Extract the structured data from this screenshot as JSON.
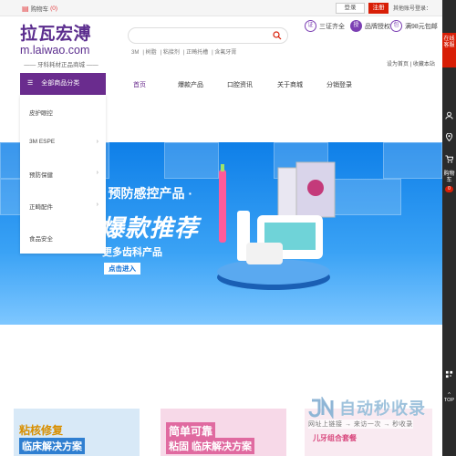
{
  "topbar": {
    "cart_label": "购物车",
    "cart_count": "(0)",
    "login": "登录",
    "register": "注册",
    "other_login": "其他账号登录："
  },
  "logo": {
    "cn": "拉瓦宏溥",
    "en": "m.laiwao.com",
    "tagline": "—— 牙科耗材正品商城 ——"
  },
  "search": {
    "placeholder": "",
    "hotwords": [
      "3M",
      "树脂",
      "粘接剂",
      "正畸托槽",
      "含氟牙膏"
    ]
  },
  "badges": [
    {
      "icon": "证",
      "label": "三证齐全"
    },
    {
      "icon": "授",
      "label": "品牌授权"
    },
    {
      "icon": "包",
      "label": "满98元包邮"
    }
  ],
  "top_links": "设为首页 | 收藏本站",
  "nav": {
    "all_categories": "全部商品分类",
    "items": [
      "首页",
      "爆款产品",
      "口腔资讯",
      "关于商城",
      "分销登录"
    ]
  },
  "categories": [
    {
      "label": "皮护眼控",
      "chevron": false
    },
    {
      "label": "3M ESPE",
      "chevron": true
    },
    {
      "label": "预防保健",
      "chevron": true
    },
    {
      "label": "正畸配件",
      "chevron": true
    },
    {
      "label": "食品安全",
      "chevron": false
    }
  ],
  "banner": {
    "line1": "· 预防感控产品 ·",
    "line2": "爆款推荐",
    "line3": "更多齿科产品",
    "button": "点击进入"
  },
  "promos": [
    {
      "title": "粘核修复",
      "sub": "临床解决方案"
    },
    {
      "title": "简单可靠",
      "sub": "粘固 临床解决方案"
    },
    {
      "title": "",
      "sub": "儿牙组合套餐"
    }
  ],
  "watermark": {
    "text": "自动秒收录",
    "slogan": "网址上链接 → 来访一次 → 秒收录"
  },
  "sidebar": {
    "online_consult": "在线客服",
    "cart": "购物车",
    "cart_count": "0",
    "top": "TOP"
  },
  "colors": {
    "brand_purple": "#6a2c8e",
    "accent_red": "#d81e06",
    "banner_blue": "#0e7fe8"
  }
}
